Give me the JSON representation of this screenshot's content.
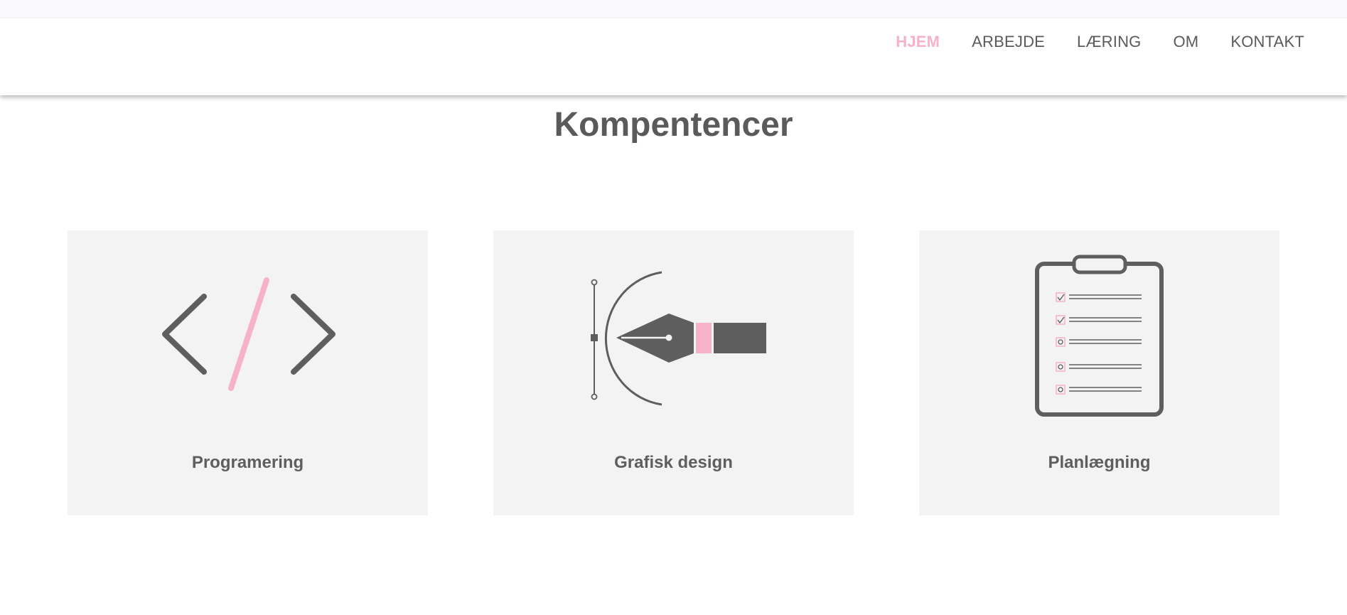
{
  "nav": {
    "items": [
      {
        "label": "HJEM",
        "active": true
      },
      {
        "label": "ARBEJDE",
        "active": false
      },
      {
        "label": "LÆRING",
        "active": false
      },
      {
        "label": "OM",
        "active": false
      },
      {
        "label": "KONTAKT",
        "active": false
      }
    ]
  },
  "section": {
    "title": "Kompentencer"
  },
  "cards": [
    {
      "label": "Programering",
      "icon": "code-icon"
    },
    {
      "label": "Grafisk design",
      "icon": "pen-tool-icon"
    },
    {
      "label": "Planlægning",
      "icon": "clipboard-checklist-icon"
    }
  ],
  "colors": {
    "accent": "#f5b2c9",
    "text": "#5e5e5e",
    "card_bg": "#f3f3f3",
    "icon": "#5e5e5e"
  }
}
